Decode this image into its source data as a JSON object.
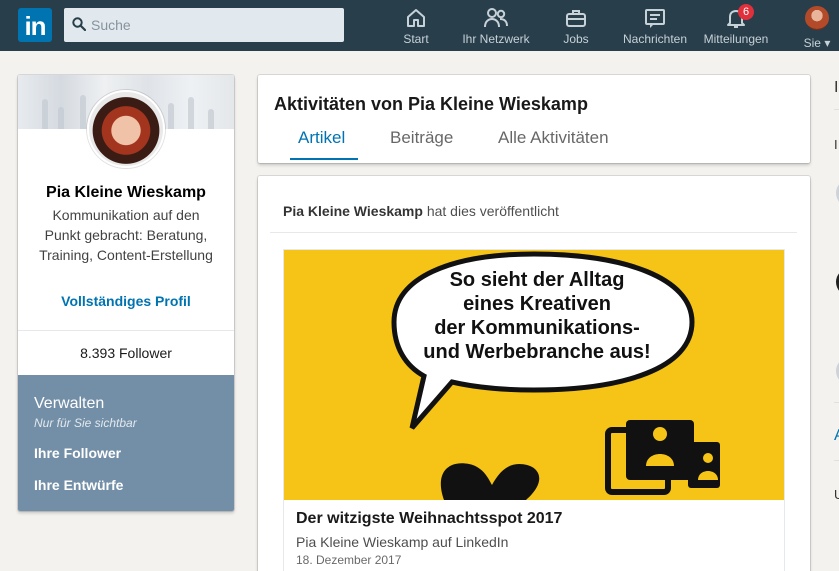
{
  "nav": {
    "logo_text": "in",
    "search_placeholder": "Suche",
    "items": [
      {
        "label": "Start",
        "icon": "home-icon"
      },
      {
        "label": "Ihr Netzwerk",
        "icon": "network-icon"
      },
      {
        "label": "Jobs",
        "icon": "briefcase-icon"
      },
      {
        "label": "Nachrichten",
        "icon": "messages-icon"
      },
      {
        "label": "Mitteilungen",
        "icon": "bell-icon",
        "badge": "6"
      },
      {
        "label": "Sie",
        "icon": "avatar"
      }
    ]
  },
  "profile": {
    "name": "Pia Kleine Wieskamp",
    "headline": "Kommunikation auf den Punkt gebracht: Beratung, Training, Content-Erstellung",
    "full_profile_link": "Vollständiges Profil",
    "followers": "8.393 Follower",
    "manage": {
      "title": "Verwalten",
      "subtitle": "Nur für Sie sichtbar",
      "links": [
        "Ihre Follower",
        "Ihre Entwürfe"
      ]
    }
  },
  "activity": {
    "title": "Aktivitäten von Pia Kleine Wieskamp",
    "tabs": [
      "Artikel",
      "Beiträge",
      "Alle Aktivitäten"
    ],
    "active_tab": "Artikel"
  },
  "post": {
    "author": "Pia Kleine Wieskamp",
    "action": " hat dies veröffentlicht",
    "image_text": [
      "So sieht  der Alltag",
      "eines Kreativen",
      "der Kommunikations-",
      "und Werbebranche aus!"
    ],
    "article_title": "Der witzigste Weihnachtsspot 2017",
    "article_author": "Pia Kleine Wieskamp auf LinkedIn",
    "article_date": "18. Dezember 2017"
  },
  "right_rail": {
    "letters": [
      "I",
      "I",
      "A",
      "U"
    ]
  },
  "colors": {
    "nav_bg": "#283e4a",
    "brand_blue": "#0073b1",
    "image_yellow": "#f6c416",
    "manage_bg": "#738fa7"
  }
}
